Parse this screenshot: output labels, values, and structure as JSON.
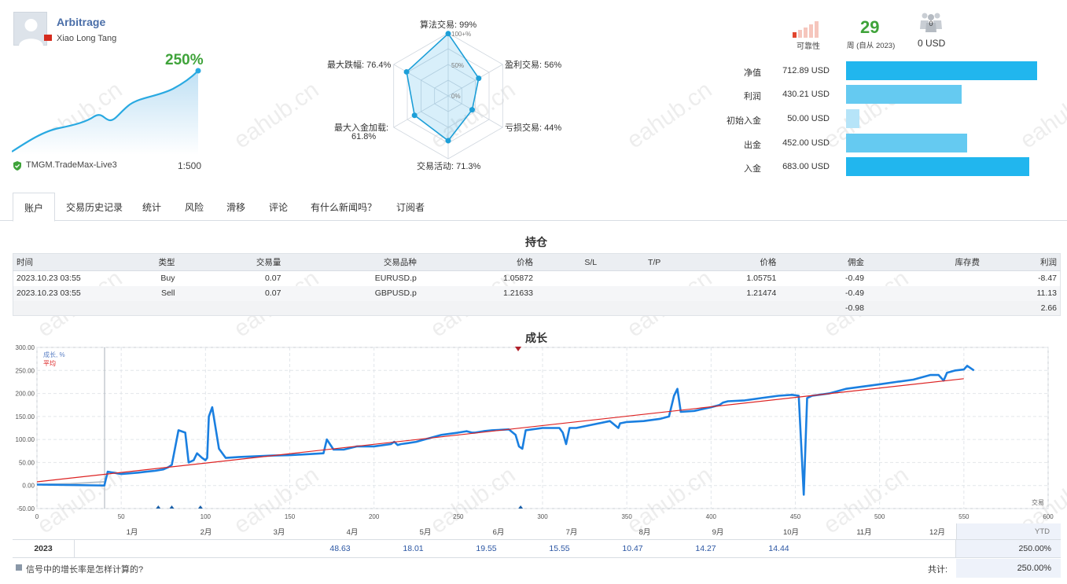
{
  "header": {
    "signal_name": "Arbitrage",
    "author": "Xiao Long Tang",
    "growth": "250%",
    "broker": "TMGM.TradeMax-Live3",
    "leverage": "1:500",
    "reliability_label": "可靠性",
    "weeks_value": "29",
    "weeks_label": "周 (自从 2023)",
    "subscribers_count": "0",
    "subscribers_usd": "0 USD"
  },
  "radar": {
    "labels": [
      "算法交易: 99%",
      "盈利交易: 56%",
      "亏损交易: 44%",
      "交易活动: 71.3%",
      "最大入金加载:",
      "61.8%",
      "最大跌幅: 76.4%"
    ],
    "scale_labels": [
      "100+%",
      "50%",
      "0%"
    ],
    "values": [
      99,
      56,
      44,
      71.3,
      61.8,
      76.4
    ]
  },
  "account_bars": [
    {
      "label": "净值",
      "value": "712.89 USD",
      "fraction": 1.0,
      "color": "#21b6ee"
    },
    {
      "label": "利润",
      "value": "430.21 USD",
      "fraction": 0.605,
      "color": "#65caf1"
    },
    {
      "label": "初始入金",
      "value": "50.00 USD",
      "fraction": 0.07,
      "color": "#b6e4f8"
    },
    {
      "label": "出金",
      "value": "452.00 USD",
      "fraction": 0.634,
      "color": "#65caf1"
    },
    {
      "label": "入金",
      "value": "683.00 USD",
      "fraction": 0.958,
      "color": "#21b6ee"
    }
  ],
  "tabs": [
    "账户",
    "交易历史记录",
    "统计",
    "风险",
    "滑移",
    "评论",
    "有什么新闻吗？",
    "订阅者"
  ],
  "positions": {
    "title": "持仓",
    "headers": [
      "时间",
      "类型",
      "交易量",
      "交易品种",
      "价格",
      "S/L",
      "T/P",
      "价格",
      "佣金",
      "库存费",
      "利润"
    ],
    "rows": [
      [
        "2023.10.23 03:55",
        "Buy",
        "0.07",
        "EURUSD.p",
        "1.05872",
        "",
        "",
        "1.05751",
        "-0.49",
        "",
        "-8.47"
      ],
      [
        "2023.10.23 03:55",
        "Sell",
        "0.07",
        "GBPUSD.p",
        "1.21633",
        "",
        "",
        "1.21474",
        "-0.49",
        "",
        "11.13"
      ]
    ],
    "total_commission": "-0.98",
    "total_profit": "2.66"
  },
  "growth_chart": {
    "title": "成长",
    "legend_growth": "成长, %",
    "legend_avg": "平均",
    "trades_label": "交易",
    "months": [
      "1月",
      "2月",
      "3月",
      "4月",
      "5月",
      "6月",
      "7月",
      "8月",
      "9月",
      "10月",
      "11月",
      "12月"
    ],
    "year": "2023",
    "ytd_label": "YTD",
    "monthly": [
      "",
      "",
      "",
      "48.63",
      "18.01",
      "19.55",
      "15.55",
      "10.47",
      "14.27",
      "14.44",
      "",
      ""
    ],
    "ytd_value": "250.00%",
    "total_label": "共计:",
    "total_value": "250.00%",
    "footer_question": "信号中的增长率是怎样计算的?"
  },
  "chart_data": {
    "type": "line",
    "title": "成长",
    "xlabel": "交易",
    "ylabel": "",
    "xlim": [
      0,
      600
    ],
    "ylim": [
      -50,
      300
    ],
    "xticks": [
      0,
      50,
      100,
      150,
      200,
      250,
      300,
      350,
      400,
      450,
      500,
      550,
      600
    ],
    "yticks": [
      "-50.00",
      "0.00",
      "50.00",
      "100.00",
      "150.00",
      "200.00",
      "250.00",
      "300.00"
    ],
    "series": [
      {
        "name": "成长, %",
        "color": "#1a7fe0",
        "x": [
          0,
          40,
          42,
          50,
          60,
          65,
          70,
          75,
          78,
          80,
          84,
          88,
          90,
          93,
          95,
          98,
          100,
          101,
          102,
          104,
          108,
          112,
          120,
          140,
          150,
          160,
          170,
          172,
          176,
          182,
          190,
          200,
          210,
          212,
          214,
          216,
          220,
          225,
          230,
          240,
          250,
          255,
          258,
          260,
          265,
          270,
          280,
          284,
          286,
          288,
          290,
          300,
          310,
          312,
          314,
          316,
          320,
          340,
          345,
          346,
          350,
          360,
          370,
          375,
          378,
          380,
          382,
          390,
          400,
          405,
          407,
          410,
          420,
          430,
          440,
          448,
          452,
          455,
          457,
          460,
          470,
          480,
          490,
          500,
          510,
          520,
          530,
          535,
          538,
          540,
          545,
          550,
          552,
          556
        ],
        "y": [
          2,
          0,
          30,
          25,
          28,
          30,
          32,
          35,
          40,
          45,
          120,
          115,
          50,
          55,
          70,
          60,
          55,
          60,
          150,
          170,
          80,
          60,
          62,
          65,
          66,
          68,
          70,
          100,
          78,
          78,
          85,
          85,
          90,
          95,
          88,
          90,
          92,
          95,
          100,
          110,
          115,
          118,
          115,
          115,
          118,
          120,
          122,
          110,
          85,
          80,
          120,
          125,
          125,
          115,
          90,
          125,
          125,
          140,
          125,
          135,
          138,
          140,
          145,
          150,
          195,
          210,
          160,
          162,
          170,
          175,
          180,
          183,
          185,
          190,
          195,
          197,
          195,
          -20,
          190,
          195,
          200,
          210,
          215,
          220,
          225,
          230,
          240,
          240,
          228,
          245,
          250,
          252,
          260,
          250
        ]
      },
      {
        "name": "平均",
        "color": "#dd2222",
        "x": [
          0,
          550
        ],
        "y": [
          8,
          232
        ]
      }
    ],
    "grid": true,
    "legend_position": "top-left"
  }
}
